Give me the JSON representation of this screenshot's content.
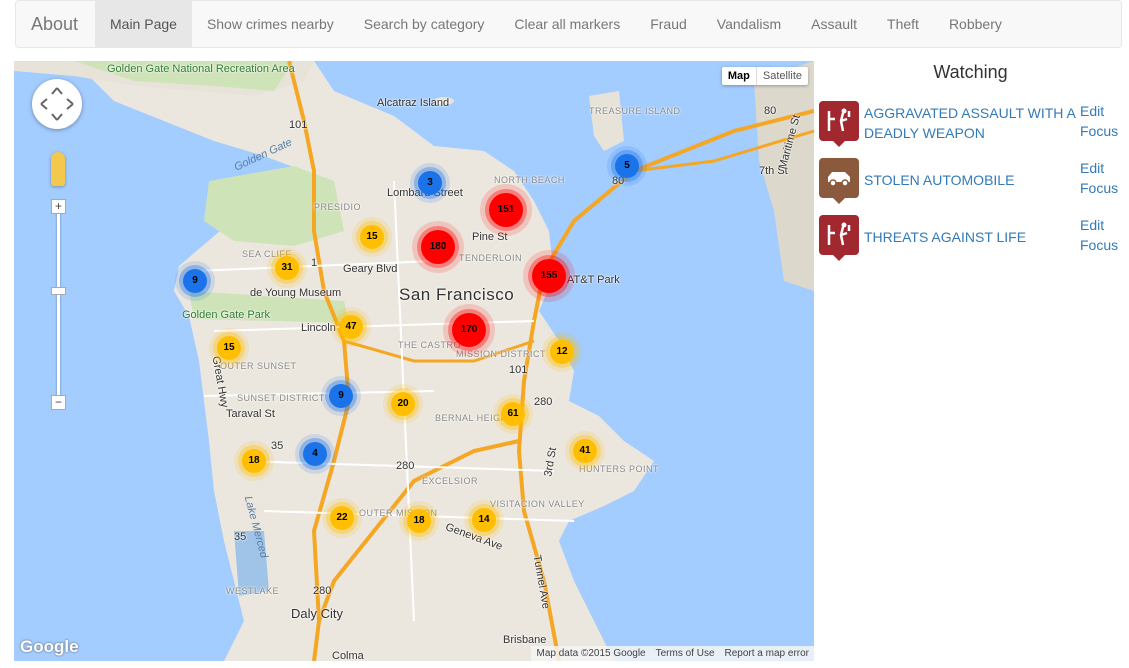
{
  "navbar": {
    "brand": "About",
    "items": [
      {
        "label": "Main Page",
        "active": true
      },
      {
        "label": "Show crimes nearby",
        "active": false
      },
      {
        "label": "Search by category",
        "active": false
      },
      {
        "label": "Clear all markers",
        "active": false
      },
      {
        "label": "Fraud",
        "active": false
      },
      {
        "label": "Vandalism",
        "active": false
      },
      {
        "label": "Assault",
        "active": false
      },
      {
        "label": "Theft",
        "active": false
      },
      {
        "label": "Robbery",
        "active": false
      }
    ]
  },
  "map": {
    "type_controls": {
      "map": "Map",
      "satellite": "Satellite"
    },
    "zoom_in": "+",
    "zoom_out": "−",
    "logo": "Google",
    "attribution": {
      "data": "Map data ©2015 Google",
      "terms": "Terms of Use",
      "report": "Report a map error"
    },
    "labels": {
      "city": "San Francisco",
      "daly_city": "Daly City",
      "brisbane": "Brisbane",
      "colma": "Colma",
      "alcatraz": "Alcatraz Island",
      "golden_gate": "Golden Gate",
      "gg_nra": "Golden Gate National Recreation Area",
      "treasure_island": "TREASURE ISLAND",
      "lombard": "Lombard Street",
      "north_beach": "NORTH BEACH",
      "presidio": "PRESIDIO",
      "sea_cliff": "SEA CLIFF",
      "geary_blvd": "Geary Blvd",
      "de_young": "de Young Museum",
      "gg_park": "Golden Gate Park",
      "lincoln_way": "Lincoln Way",
      "outer_sunset": "OUTER SUNSET",
      "sunset_district": "SUNSET DISTRICT",
      "taraval": "Taraval St",
      "great_hwy": "Great Hwy",
      "castro": "THE CASTRO",
      "mission": "MISSION DISTRICT",
      "tenderloin": "TENDERLOIN",
      "pine_st": "Pine St",
      "att_park": "AT&T Park",
      "bernal": "BERNAL HEIGHTS",
      "excelsior": "EXCELSIOR",
      "visitacion": "VISITACION VALLEY",
      "hunters_point": "HUNTERS POINT",
      "outer_mission": "OUTER MISSION",
      "geneva_ave": "Geneva Ave",
      "westlake": "WESTLAKE",
      "lake_merced": "Lake Merced",
      "tunnel_ave": "Tunnel Ave",
      "third_st": "3rd St",
      "seventh_st": "7th St",
      "maritime": "Maritime St",
      "rt_101a": "101",
      "rt_101b": "101",
      "rt_1": "1",
      "rt_35a": "35",
      "rt_35b": "35",
      "rt_280a": "280",
      "rt_280b": "280",
      "rt_280c": "280",
      "rt_80a": "80",
      "rt_80b": "80"
    },
    "clusters": [
      {
        "count": "3",
        "level": "blue"
      },
      {
        "count": "151",
        "level": "red"
      },
      {
        "count": "5",
        "level": "blue"
      },
      {
        "count": "15",
        "level": "yellow"
      },
      {
        "count": "180",
        "level": "red"
      },
      {
        "count": "31",
        "level": "yellow"
      },
      {
        "count": "9",
        "level": "blue"
      },
      {
        "count": "155",
        "level": "red"
      },
      {
        "count": "47",
        "level": "yellow"
      },
      {
        "count": "170",
        "level": "red"
      },
      {
        "count": "15",
        "level": "yellow"
      },
      {
        "count": "12",
        "level": "yellow"
      },
      {
        "count": "9",
        "level": "blue"
      },
      {
        "count": "20",
        "level": "yellow"
      },
      {
        "count": "61",
        "level": "yellow"
      },
      {
        "count": "18",
        "level": "yellow"
      },
      {
        "count": "4",
        "level": "blue"
      },
      {
        "count": "41",
        "level": "yellow"
      },
      {
        "count": "22",
        "level": "yellow"
      },
      {
        "count": "18",
        "level": "yellow"
      },
      {
        "count": "14",
        "level": "yellow"
      }
    ]
  },
  "watching": {
    "title": "Watching",
    "items": [
      {
        "name": "AGGRAVATED ASSAULT WITH A DEADLY WEAPON",
        "edit": "Edit",
        "focus": "Focus",
        "icon": "assault-icon",
        "color": "#a0282e"
      },
      {
        "name": "STOLEN AUTOMOBILE",
        "edit": "Edit",
        "focus": "Focus",
        "icon": "car-icon",
        "color": "#8b5a3c"
      },
      {
        "name": "THREATS AGAINST LIFE",
        "edit": "Edit",
        "focus": "Focus",
        "icon": "assault-icon",
        "color": "#a0282e"
      }
    ]
  }
}
